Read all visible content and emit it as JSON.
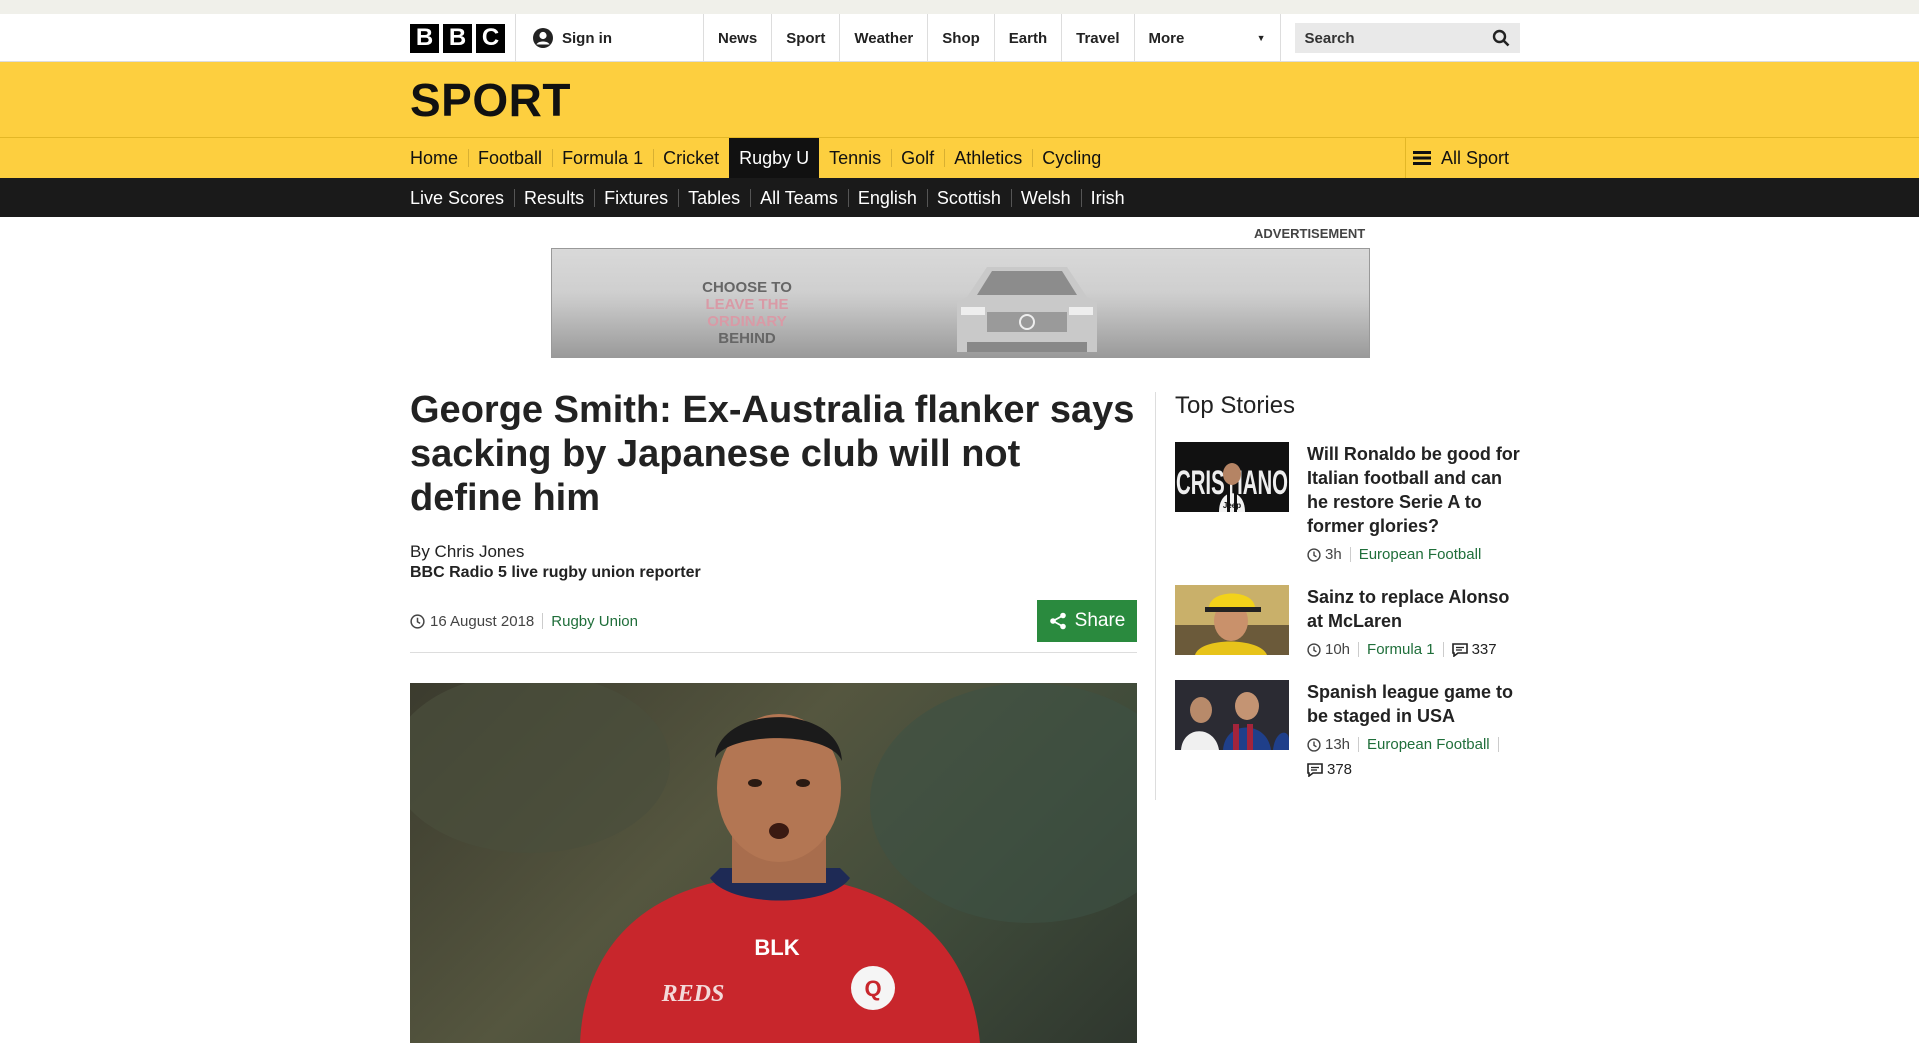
{
  "bbc": {
    "logo_letters": [
      "B",
      "B",
      "C"
    ],
    "signin_label": "Sign in",
    "nav": [
      "News",
      "Sport",
      "Weather",
      "Shop",
      "Earth",
      "Travel"
    ],
    "more_label": "More",
    "search_placeholder": "Search"
  },
  "sport": {
    "title": "SPORT",
    "nav": [
      "Home",
      "Football",
      "Formula 1",
      "Cricket",
      "Rugby U",
      "Tennis",
      "Golf",
      "Athletics",
      "Cycling"
    ],
    "active_index": 4,
    "all_sport_label": "All Sport",
    "sub_nav": [
      "Live Scores",
      "Results",
      "Fixtures",
      "Tables",
      "All Teams",
      "English",
      "Scottish",
      "Welsh",
      "Irish"
    ]
  },
  "ad": {
    "label": "ADVERTISEMENT",
    "line1": "CHOOSE TO",
    "line2": "LEAVE THE ORDINARY",
    "line3": "BEHIND"
  },
  "article": {
    "headline": "George Smith: Ex-Australia flanker says sacking by Japanese club will not define him",
    "author": "By Chris Jones",
    "role": "BBC Radio 5 live rugby union reporter",
    "date": "16 August 2018",
    "topic": "Rugby Union",
    "share_label": "Share",
    "image_text": {
      "sponsor": "BLK",
      "team": "REDS",
      "badge": "Q"
    }
  },
  "sidebar": {
    "title": "Top Stories",
    "stories": [
      {
        "title": "Will Ronaldo be good for Italian football and can he restore Serie A to former glories?",
        "time": "3h",
        "topic": "European Football",
        "comments": "",
        "thumb_text": "CRISTIANO",
        "thumb_sponsor": "Jeep"
      },
      {
        "title": "Sainz to replace Alonso at McLaren",
        "time": "10h",
        "topic": "Formula 1",
        "comments": "337"
      },
      {
        "title": "Spanish league game to be staged in USA",
        "time": "13h",
        "topic": "European Football",
        "comments": "378"
      }
    ]
  },
  "colors": {
    "sport_yellow": "#fdcf3f",
    "subnav_black": "#1a1a1a",
    "share_green": "#2a8a3e",
    "topic_green": "#1f6e3a"
  }
}
